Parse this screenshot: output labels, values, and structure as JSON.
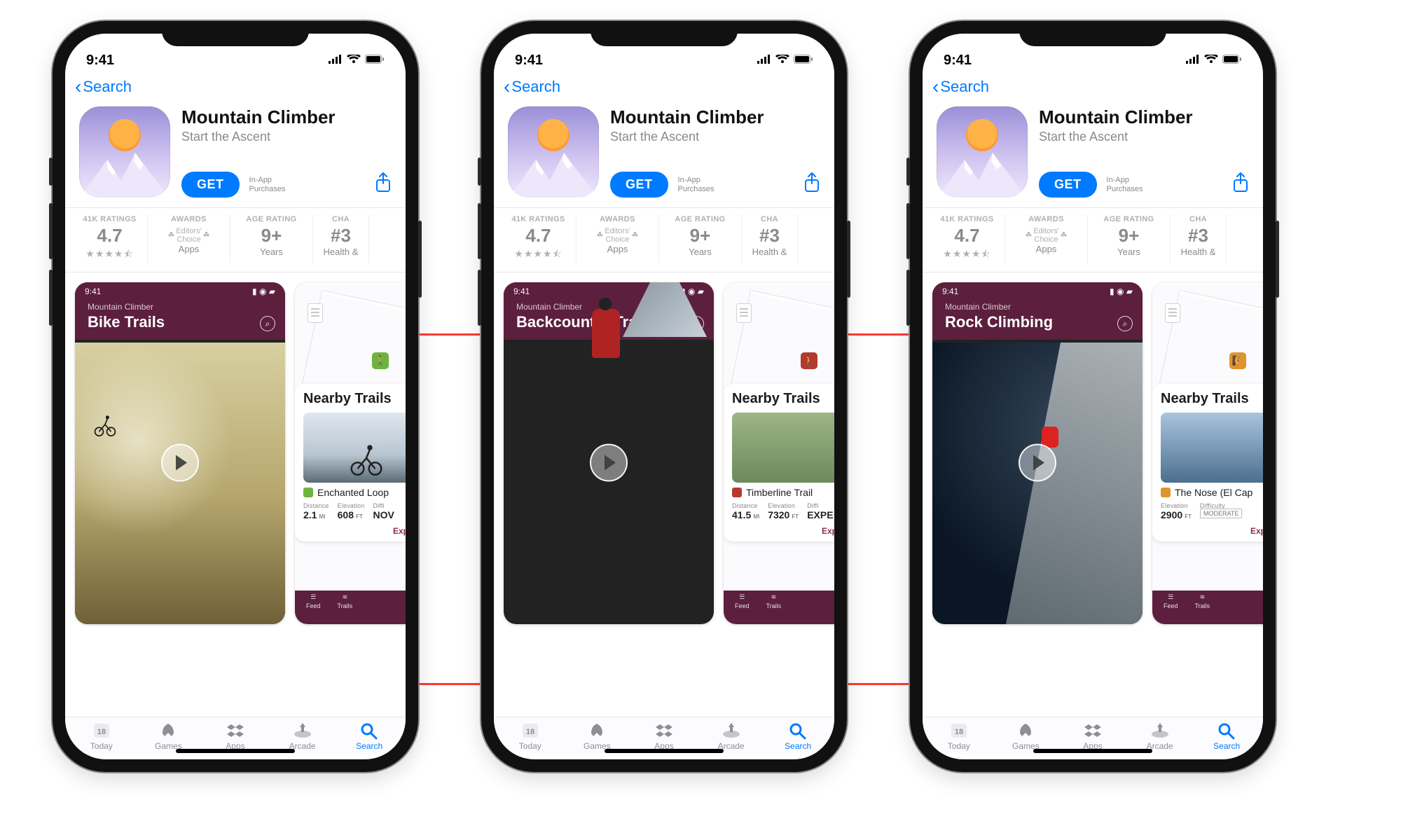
{
  "statusbar": {
    "time": "9:41"
  },
  "nav": {
    "back_label": "Search"
  },
  "app": {
    "name": "Mountain Climber",
    "subtitle": "Start the Ascent",
    "get_label": "GET",
    "iap_line1": "In-App",
    "iap_line2": "Purchases"
  },
  "stats": {
    "ratings_heading": "41K RATINGS",
    "rating_value": "4.7",
    "awards_heading": "AWARDS",
    "award_line1": "Editors'",
    "award_line2": "Choice",
    "awards_sub": "Apps",
    "age_heading": "AGE RATING",
    "age_value": "9+",
    "age_sub": "Years",
    "chart_heading_partial": "CHA",
    "chart_value_partial": "#3",
    "chart_sub_partial": "Health &"
  },
  "screenshots": {
    "brand": "Mountain Climber",
    "nearby_heading": "Nearby Trails",
    "expand_label_partial": "Expand Sea",
    "inner_time": "9:41",
    "bike": {
      "title": "Bike Trails",
      "trail_name": "Enchanted Loop",
      "distance_label": "Distance",
      "distance_val": "2.1",
      "distance_unit": "MI",
      "elev_label": "Elevation",
      "elev_val": "608",
      "elev_unit": "FT",
      "diff_label": "Diffi",
      "diff_val": "NOV"
    },
    "back": {
      "title": "Backcountry Trails",
      "trail_name": "Timberline Trail",
      "distance_label": "Distance",
      "distance_val": "41.5",
      "distance_unit": "MI",
      "elev_label": "Elevation",
      "elev_val": "7320",
      "elev_unit": "FT",
      "diff_label": "Diffi",
      "diff_val": "EXPE"
    },
    "rock": {
      "title": "Rock Climbing",
      "trail_name": "The Nose (El Cap",
      "elev_label": "Elevation",
      "elev_val": "2900",
      "elev_unit": "FT",
      "diff_label": "Difficulty",
      "diff_val": "MODERATE"
    },
    "purplebar": {
      "feed": "Feed",
      "trails": "Trails"
    }
  },
  "tabs": {
    "today": "Today",
    "games": "Games",
    "apps": "Apps",
    "arcade": "Arcade",
    "search": "Search"
  }
}
